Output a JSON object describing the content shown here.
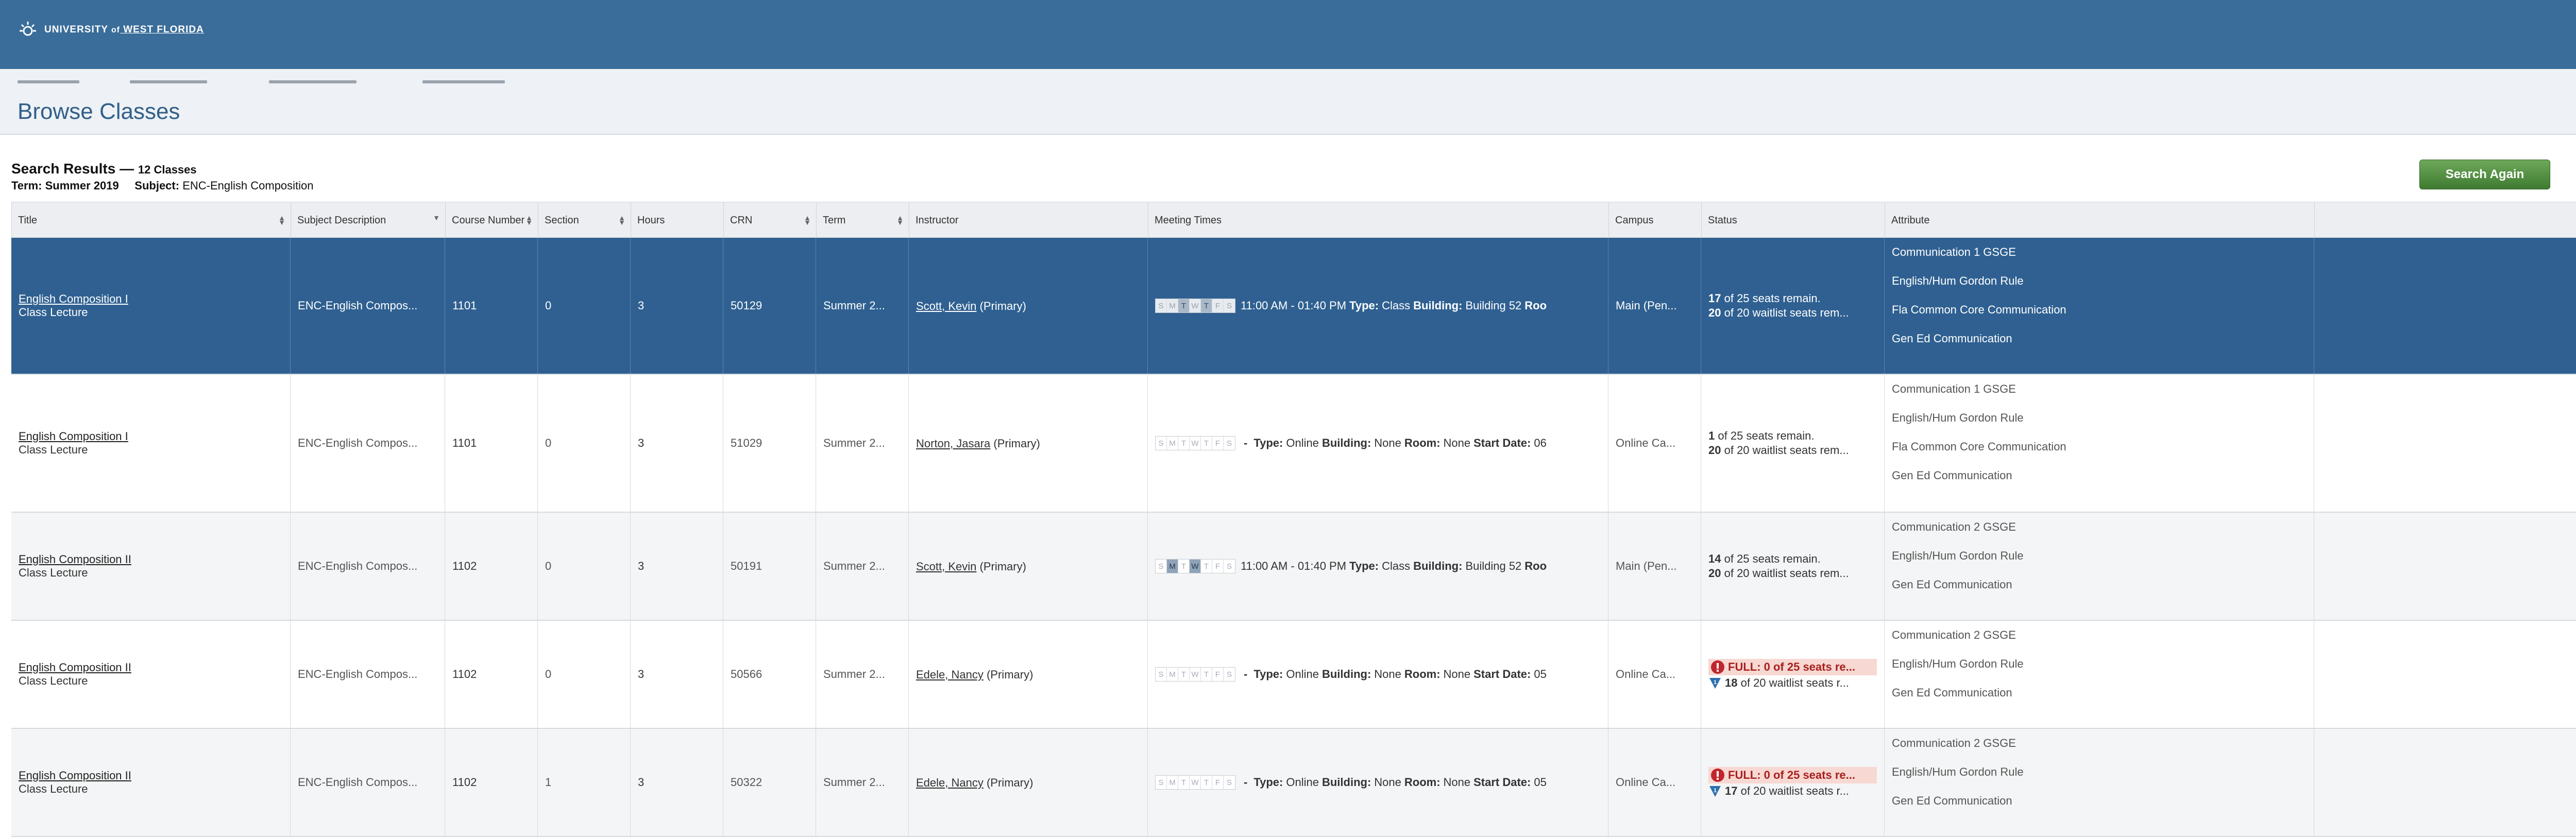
{
  "header": {
    "logo_text_a": "UNIVERSITY ",
    "logo_text_of": "of",
    "logo_text_b": " WEST FLORIDA"
  },
  "page": {
    "title": "Browse Classes"
  },
  "summary": {
    "heading": "Search Results — ",
    "count": "12 Classes",
    "term_label": "Term:",
    "term_value": "Summer 2019",
    "subject_label": "Subject:",
    "subject_value": "ENC-English Composition"
  },
  "search_again_label": "Search Again",
  "columns": [
    "Title",
    "Subject Description",
    "Course Number",
    "Section",
    "Hours",
    "CRN",
    "Term",
    "Instructor",
    "Meeting Times",
    "Campus",
    "Status",
    "Attribute"
  ],
  "day_letters": [
    "S",
    "M",
    "T",
    "W",
    "T",
    "F",
    "S"
  ],
  "rows": [
    {
      "title": "English Composition I",
      "subtitle": "Class Lecture",
      "subject": "ENC-English Compos...",
      "course": "1101",
      "section": "0",
      "hours": "3",
      "crn": "50129",
      "term": "Summer 2...",
      "instructor": "Scott, Kevin",
      "instructor_role": "(Primary)",
      "days_on": [
        2,
        4
      ],
      "meeting": "11:00 AM - 01:40 PM",
      "type_label": "Type:",
      "type": "Class",
      "building_label": "Building:",
      "building": "Building 52",
      "extra_label": "Roo",
      "campus": "Main (Pen...",
      "status_a_num": "17",
      "status_a": "of 25 seats remain.",
      "status_b_num": "20",
      "status_b": "of 20 waitlist seats rem...",
      "attributes": [
        "Communication 1 GSGE",
        "English/Hum Gordon Rule",
        "Fla Common Core Communication",
        "Gen Ed Communication"
      ]
    },
    {
      "title": "English Composition I",
      "subtitle": "Class Lecture",
      "subject": "ENC-English Compos...",
      "course": "1101",
      "section": "0",
      "hours": "3",
      "crn": "51029",
      "term": "Summer 2...",
      "instructor": "Norton, Jasara",
      "instructor_role": "(Primary)",
      "days_on": [],
      "meeting": "-",
      "type_label": "Type:",
      "type": "Online",
      "building_label": "Building:",
      "building": "None",
      "room_label": "Room:",
      "room": "None",
      "start_label": "Start Date:",
      "start": "06",
      "campus": "Online Ca...",
      "status_a_num": "1",
      "status_a": "of 25 seats remain.",
      "status_b_num": "20",
      "status_b": "of 20 waitlist seats rem...",
      "attributes": [
        "Communication 1 GSGE",
        "English/Hum Gordon Rule",
        "Fla Common Core Communication",
        "Gen Ed Communication"
      ]
    },
    {
      "title": "English Composition II",
      "subtitle": "Class Lecture",
      "subject": "ENC-English Compos...",
      "course": "1102",
      "section": "0",
      "hours": "3",
      "crn": "50191",
      "term": "Summer 2...",
      "instructor": "Scott, Kevin",
      "instructor_role": "(Primary)",
      "days_on": [
        1,
        3
      ],
      "meeting": "11:00 AM - 01:40 PM",
      "type_label": "Type:",
      "type": "Class",
      "building_label": "Building:",
      "building": "Building 52",
      "extra_label": "Roo",
      "campus": "Main (Pen...",
      "status_a_num": "14",
      "status_a": "of 25 seats remain.",
      "status_b_num": "20",
      "status_b": "of 20 waitlist seats rem...",
      "attributes": [
        "Communication 2 GSGE",
        "English/Hum Gordon Rule",
        "Gen Ed Communication"
      ]
    },
    {
      "title": "English Composition II",
      "subtitle": "Class Lecture",
      "subject": "ENC-English Compos...",
      "course": "1102",
      "section": "0",
      "hours": "3",
      "crn": "50566",
      "term": "Summer 2...",
      "instructor": "Edele, Nancy",
      "instructor_role": "(Primary)",
      "days_on": [],
      "meeting": "-",
      "type_label": "Type:",
      "type": "Online",
      "building_label": "Building:",
      "building": "None",
      "room_label": "Room:",
      "room": "None",
      "start_label": "Start Date:",
      "start": "05",
      "campus": "Online Ca...",
      "full_text": "FULL: 0 of 25 seats re...",
      "status_b_num": "18",
      "status_b": "of 20 waitlist seats r...",
      "attributes": [
        "Communication 2 GSGE",
        "English/Hum Gordon Rule",
        "Gen Ed Communication"
      ]
    },
    {
      "title": "English Composition II",
      "subtitle": "Class Lecture",
      "subject": "ENC-English Compos...",
      "course": "1102",
      "section": "1",
      "hours": "3",
      "crn": "50322",
      "term": "Summer 2...",
      "instructor": "Edele, Nancy",
      "instructor_role": "(Primary)",
      "days_on": [],
      "meeting": "-",
      "type_label": "Type:",
      "type": "Online",
      "building_label": "Building:",
      "building": "None",
      "room_label": "Room:",
      "room": "None",
      "start_label": "Start Date:",
      "start": "05",
      "campus": "Online Ca...",
      "full_text": "FULL: 0 of 25 seats re...",
      "status_b_num": "17",
      "status_b": "of 20 waitlist seats r...",
      "attributes": [
        "Communication 2 GSGE",
        "English/Hum Gordon Rule",
        "Gen Ed Communication"
      ]
    }
  ],
  "colors": {
    "topbar": "#3a6d9a",
    "selected_row": "#2f6091",
    "button_green": "#4f8a3f",
    "full_bg": "#f7d8d2"
  }
}
